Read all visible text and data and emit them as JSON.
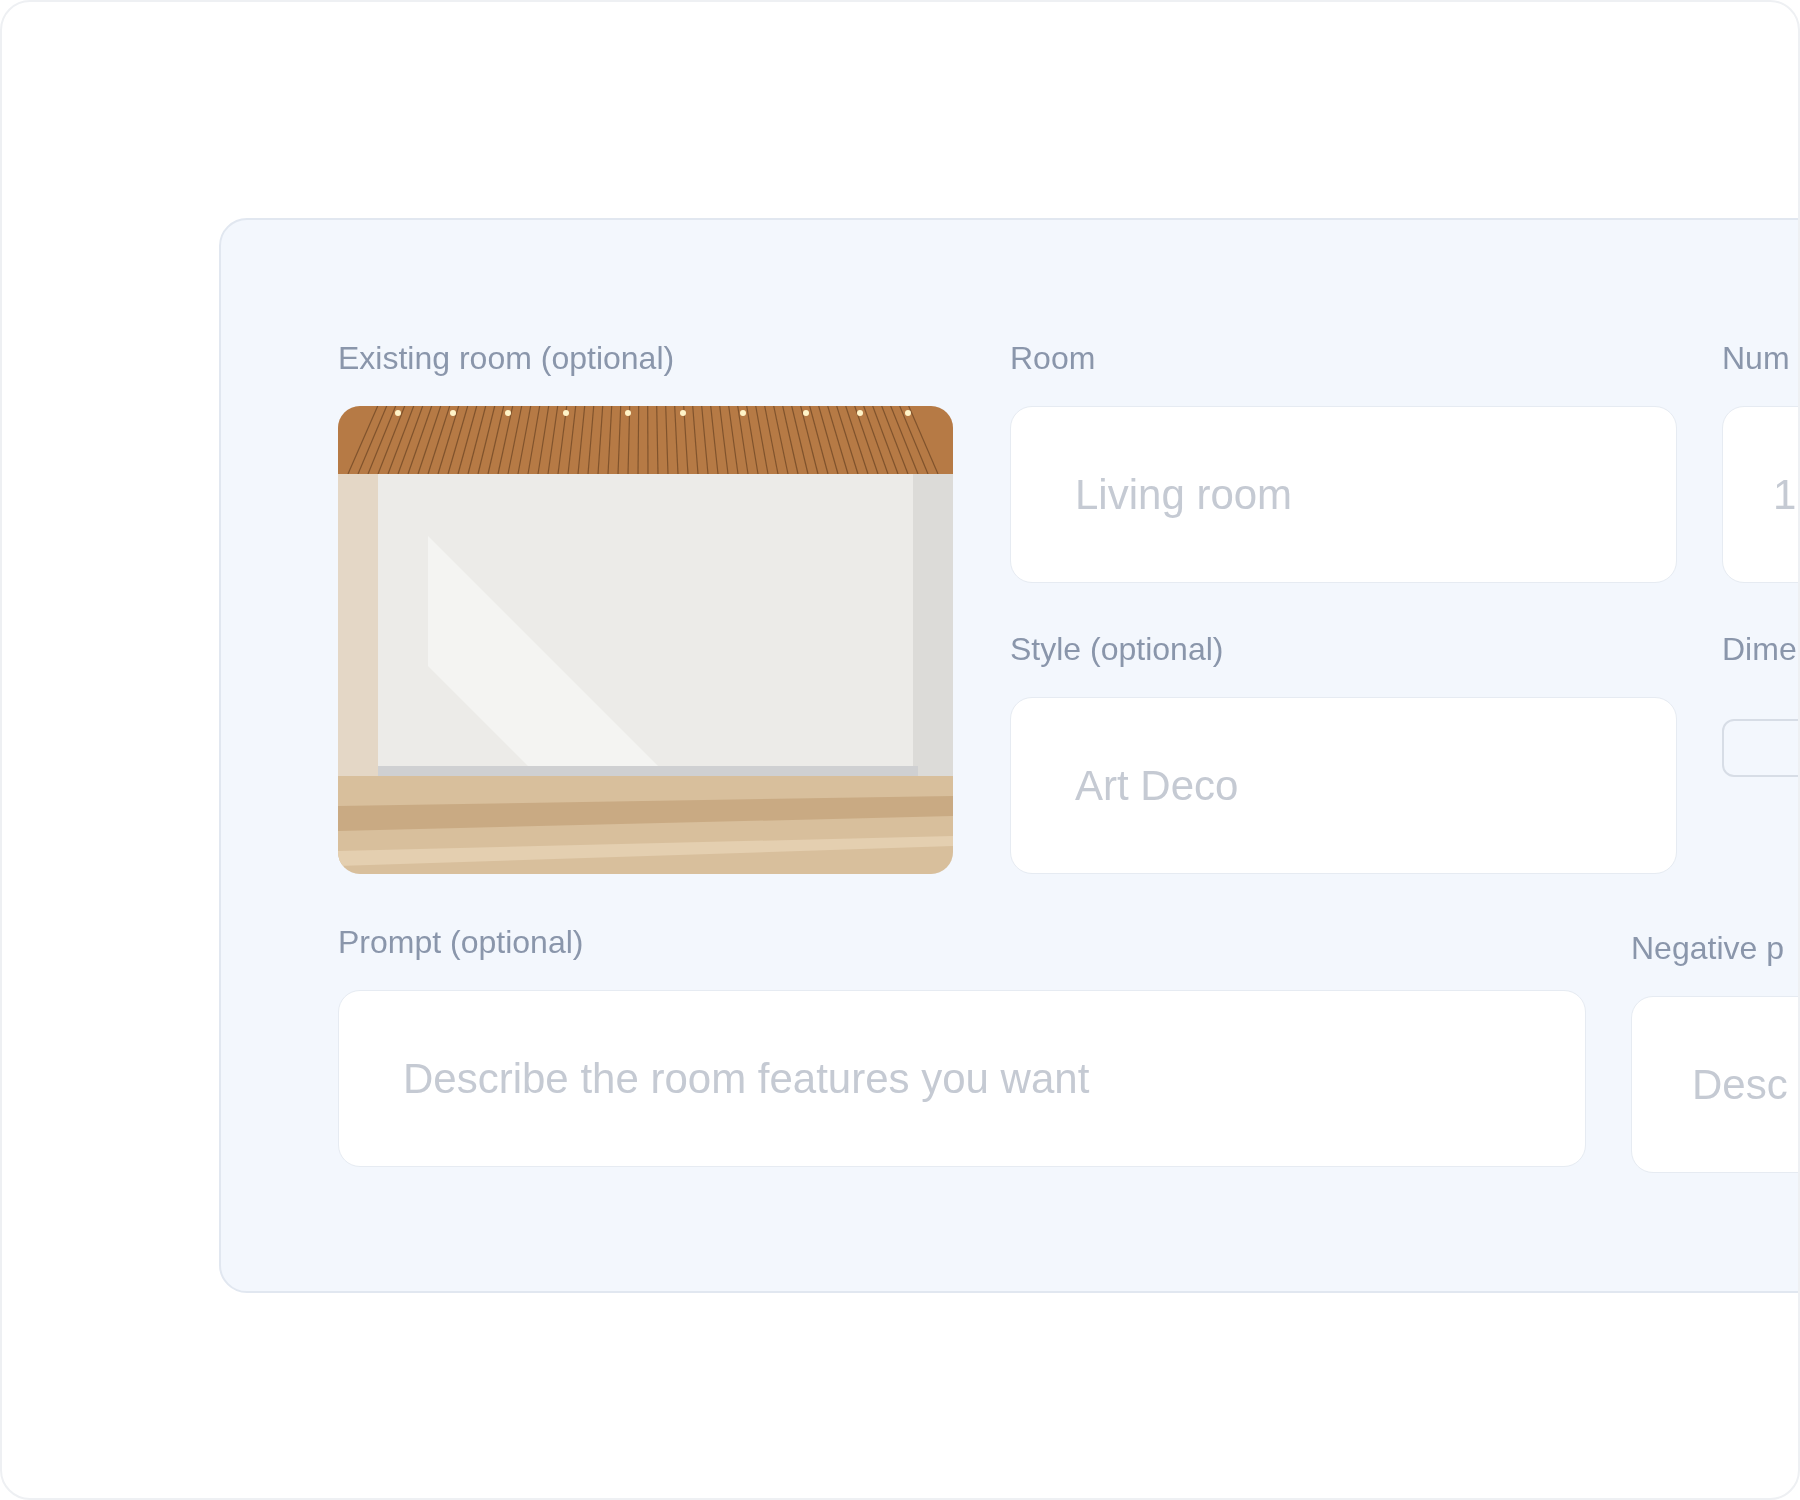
{
  "existing_room": {
    "label": "Existing room (optional)"
  },
  "room": {
    "label": "Room",
    "placeholder": "Living room"
  },
  "number": {
    "label": "Num",
    "placeholder": "1"
  },
  "style": {
    "label": "Style (optional)",
    "placeholder": "Art Deco"
  },
  "dimension": {
    "label": "Dime"
  },
  "prompt": {
    "label": "Prompt (optional)",
    "placeholder": "Describe the room features you want"
  },
  "negative_prompt": {
    "label": "Negative p",
    "placeholder": "Desc"
  }
}
